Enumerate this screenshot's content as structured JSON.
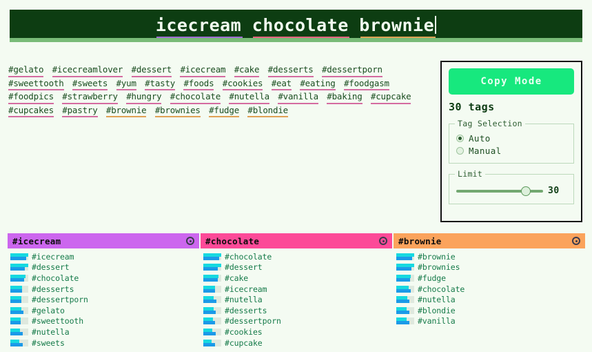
{
  "search": {
    "query": "icecream chocolate brownie",
    "terms": [
      {
        "text": "icecream",
        "color": "#a06cd5"
      },
      {
        "text": "chocolate",
        "color": "#e8627f"
      },
      {
        "text": "brownie",
        "color": "#e0a155"
      }
    ],
    "caret_visible": true
  },
  "tagcloud": {
    "tags": [
      {
        "label": "#gelato",
        "color": "#d46ba0"
      },
      {
        "label": "#icecreamlover",
        "color": "#d46ba0"
      },
      {
        "label": "#dessert",
        "color": "#d46ba0"
      },
      {
        "label": "#icecream",
        "color": "#d46ba0"
      },
      {
        "label": "#cake",
        "color": "#d46ba0"
      },
      {
        "label": "#desserts",
        "color": "#d46ba0"
      },
      {
        "label": "#dessertporn",
        "color": "#d46ba0"
      },
      {
        "label": "#sweettooth",
        "color": "#d46ba0"
      },
      {
        "label": "#sweets",
        "color": "#d46ba0"
      },
      {
        "label": "#yum",
        "color": "#d46ba0"
      },
      {
        "label": "#tasty",
        "color": "#d46ba0"
      },
      {
        "label": "#foods",
        "color": "#d46ba0"
      },
      {
        "label": "#cookies",
        "color": "#d46ba0"
      },
      {
        "label": "#eat",
        "color": "#d46ba0"
      },
      {
        "label": "#eating",
        "color": "#d46ba0"
      },
      {
        "label": "#foodgasm",
        "color": "#d46ba0"
      },
      {
        "label": "#foodpics",
        "color": "#d46ba0"
      },
      {
        "label": "#strawberry",
        "color": "#d46ba0"
      },
      {
        "label": "#hungry",
        "color": "#d46ba0"
      },
      {
        "label": "#chocolate",
        "color": "#d46ba0"
      },
      {
        "label": "#nutella",
        "color": "#d46ba0"
      },
      {
        "label": "#vanilla",
        "color": "#d46ba0"
      },
      {
        "label": "#baking",
        "color": "#d46ba0"
      },
      {
        "label": "#cupcake",
        "color": "#d46ba0"
      },
      {
        "label": "#cupcakes",
        "color": "#d46ba0"
      },
      {
        "label": "#pastry",
        "color": "#d46ba0"
      },
      {
        "label": "#brownie",
        "color": "#e0a155"
      },
      {
        "label": "#brownies",
        "color": "#e0a155"
      },
      {
        "label": "#fudge",
        "color": "#e0a155"
      },
      {
        "label": "#blondie",
        "color": "#e0a155"
      }
    ]
  },
  "panel": {
    "copy_mode_label": "Copy Mode",
    "tag_count_label": "30 tags",
    "tag_selection": {
      "legend": "Tag Selection",
      "options": [
        {
          "label": "Auto",
          "selected": true
        },
        {
          "label": "Manual",
          "selected": false
        }
      ]
    },
    "limit": {
      "legend": "Limit",
      "value": "30",
      "thumb_pct": 80
    },
    "accent_green": "#17e87e"
  },
  "results": {
    "columns": [
      {
        "title": "#icecream",
        "header_color": "#cc66ee",
        "icon": "target-icon",
        "items": [
          {
            "label": "#icecream",
            "top_pct": 100,
            "bot_pct": 88
          },
          {
            "label": "#dessert",
            "top_pct": 100,
            "bot_pct": 82
          },
          {
            "label": "#chocolate",
            "top_pct": 84,
            "bot_pct": 78
          },
          {
            "label": "#desserts",
            "top_pct": 66,
            "bot_pct": 66
          },
          {
            "label": "#dessertporn",
            "top_pct": 62,
            "bot_pct": 62
          },
          {
            "label": "#gelato",
            "top_pct": 60,
            "bot_pct": 72
          },
          {
            "label": "#sweettooth",
            "top_pct": 58,
            "bot_pct": 56
          },
          {
            "label": "#nutella",
            "top_pct": 52,
            "bot_pct": 70
          },
          {
            "label": "#sweets",
            "top_pct": 50,
            "bot_pct": 68
          }
        ]
      },
      {
        "title": "#chocolate",
        "header_color": "#fc4a98",
        "icon": "target-icon",
        "items": [
          {
            "label": "#chocolate",
            "top_pct": 100,
            "bot_pct": 88
          },
          {
            "label": "#dessert",
            "top_pct": 100,
            "bot_pct": 82
          },
          {
            "label": "#cake",
            "top_pct": 84,
            "bot_pct": 80
          },
          {
            "label": "#icecream",
            "top_pct": 66,
            "bot_pct": 66
          },
          {
            "label": "#nutella",
            "top_pct": 58,
            "bot_pct": 72
          },
          {
            "label": "#desserts",
            "top_pct": 56,
            "bot_pct": 68
          },
          {
            "label": "#dessertporn",
            "top_pct": 54,
            "bot_pct": 64
          },
          {
            "label": "#cookies",
            "top_pct": 50,
            "bot_pct": 70
          },
          {
            "label": "#cupcake",
            "top_pct": 48,
            "bot_pct": 66
          }
        ]
      },
      {
        "title": "#brownie",
        "header_color": "#fba35c",
        "icon": "target-icon",
        "items": [
          {
            "label": "#brownie",
            "top_pct": 100,
            "bot_pct": 88
          },
          {
            "label": "#brownies",
            "top_pct": 100,
            "bot_pct": 86
          },
          {
            "label": "#fudge",
            "top_pct": 82,
            "bot_pct": 76
          },
          {
            "label": "#chocolate",
            "top_pct": 68,
            "bot_pct": 80
          },
          {
            "label": "#nutella",
            "top_pct": 60,
            "bot_pct": 74
          },
          {
            "label": "#blondie",
            "top_pct": 58,
            "bot_pct": 72
          },
          {
            "label": "#vanilla",
            "top_pct": 56,
            "bot_pct": 74
          }
        ]
      }
    ]
  }
}
